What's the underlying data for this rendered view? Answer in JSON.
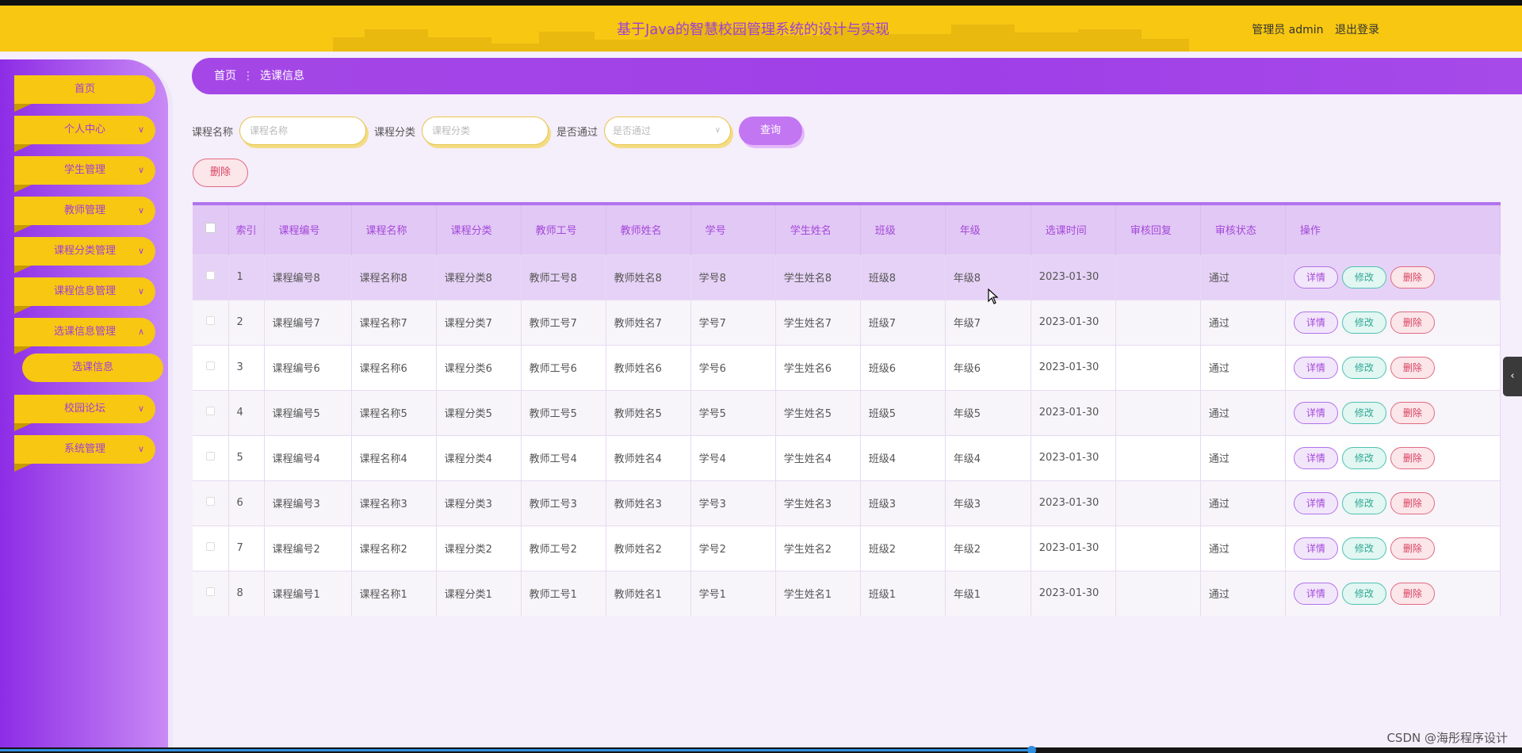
{
  "header": {
    "title": "基于Java的智慧校园管理系统的设计与实现",
    "user_label": "管理员 admin",
    "logout_label": "退出登录"
  },
  "sidebar": {
    "items": [
      {
        "label": "首页",
        "has_chevron": false
      },
      {
        "label": "个人中心",
        "has_chevron": true
      },
      {
        "label": "学生管理",
        "has_chevron": true
      },
      {
        "label": "教师管理",
        "has_chevron": true
      },
      {
        "label": "课程分类管理",
        "has_chevron": true
      },
      {
        "label": "课程信息管理",
        "has_chevron": true
      },
      {
        "label": "选课信息管理",
        "has_chevron": true,
        "expanded": true
      },
      {
        "label": "校园论坛",
        "has_chevron": true
      },
      {
        "label": "系统管理",
        "has_chevron": true
      }
    ],
    "subitem": "选课信息"
  },
  "breadcrumb": {
    "home": "首页",
    "separator": "⋮",
    "current": "选课信息"
  },
  "search": {
    "course_name_label": "课程名称",
    "course_name_placeholder": "课程名称",
    "course_category_label": "课程分类",
    "course_category_placeholder": "课程分类",
    "passed_label": "是否通过",
    "passed_placeholder": "是否通过",
    "query_button": "查询"
  },
  "toolbar": {
    "delete_label": "删除"
  },
  "table": {
    "columns": [
      "索引",
      "课程编号",
      "课程名称",
      "课程分类",
      "教师工号",
      "教师姓名",
      "学号",
      "学生姓名",
      "班级",
      "年级",
      "选课时间",
      "审核回复",
      "审核状态",
      "操作"
    ],
    "rows": [
      {
        "index": "1",
        "course_no": "课程编号8",
        "course_name": "课程名称8",
        "course_cat": "课程分类8",
        "teacher_id": "教师工号8",
        "teacher_name": "教师姓名8",
        "student_id": "学号8",
        "student_name": "学生姓名8",
        "class": "班级8",
        "grade": "年级8",
        "time": "2023-01-30",
        "reply": "",
        "status": "通过"
      },
      {
        "index": "2",
        "course_no": "课程编号7",
        "course_name": "课程名称7",
        "course_cat": "课程分类7",
        "teacher_id": "教师工号7",
        "teacher_name": "教师姓名7",
        "student_id": "学号7",
        "student_name": "学生姓名7",
        "class": "班级7",
        "grade": "年级7",
        "time": "2023-01-30",
        "reply": "",
        "status": "通过"
      },
      {
        "index": "3",
        "course_no": "课程编号6",
        "course_name": "课程名称6",
        "course_cat": "课程分类6",
        "teacher_id": "教师工号6",
        "teacher_name": "教师姓名6",
        "student_id": "学号6",
        "student_name": "学生姓名6",
        "class": "班级6",
        "grade": "年级6",
        "time": "2023-01-30",
        "reply": "",
        "status": "通过"
      },
      {
        "index": "4",
        "course_no": "课程编号5",
        "course_name": "课程名称5",
        "course_cat": "课程分类5",
        "teacher_id": "教师工号5",
        "teacher_name": "教师姓名5",
        "student_id": "学号5",
        "student_name": "学生姓名5",
        "class": "班级5",
        "grade": "年级5",
        "time": "2023-01-30",
        "reply": "",
        "status": "通过"
      },
      {
        "index": "5",
        "course_no": "课程编号4",
        "course_name": "课程名称4",
        "course_cat": "课程分类4",
        "teacher_id": "教师工号4",
        "teacher_name": "教师姓名4",
        "student_id": "学号4",
        "student_name": "学生姓名4",
        "class": "班级4",
        "grade": "年级4",
        "time": "2023-01-30",
        "reply": "",
        "status": "通过"
      },
      {
        "index": "6",
        "course_no": "课程编号3",
        "course_name": "课程名称3",
        "course_cat": "课程分类3",
        "teacher_id": "教师工号3",
        "teacher_name": "教师姓名3",
        "student_id": "学号3",
        "student_name": "学生姓名3",
        "class": "班级3",
        "grade": "年级3",
        "time": "2023-01-30",
        "reply": "",
        "status": "通过"
      },
      {
        "index": "7",
        "course_no": "课程编号2",
        "course_name": "课程名称2",
        "course_cat": "课程分类2",
        "teacher_id": "教师工号2",
        "teacher_name": "教师姓名2",
        "student_id": "学号2",
        "student_name": "学生姓名2",
        "class": "班级2",
        "grade": "年级2",
        "time": "2023-01-30",
        "reply": "",
        "status": "通过"
      },
      {
        "index": "8",
        "course_no": "课程编号1",
        "course_name": "课程名称1",
        "course_cat": "课程分类1",
        "teacher_id": "教师工号1",
        "teacher_name": "教师姓名1",
        "student_id": "学号1",
        "student_name": "学生姓名1",
        "class": "班级1",
        "grade": "年级1",
        "time": "2023-01-30",
        "reply": "",
        "status": "通过"
      }
    ],
    "actions": {
      "detail": "详情",
      "edit": "修改",
      "delete": "删除"
    }
  },
  "watermark": "CSDN @海彤程序设计",
  "colors": {
    "header_bg": "#f7c712",
    "accent_purple": "#a348d8",
    "sidebar_gradient_start": "#8d2ce6"
  }
}
